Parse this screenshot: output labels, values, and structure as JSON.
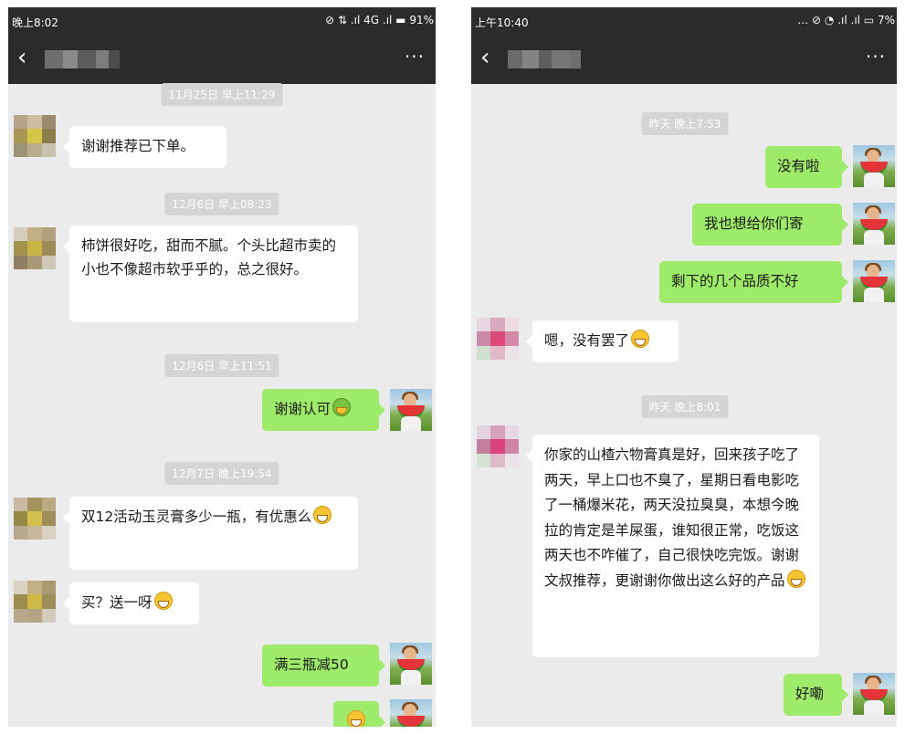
{
  "left_screen": {
    "status": {
      "time": "晚上8:02",
      "icons": "⊘ ⇅ .ıl 4G .ıl ▬ 91%"
    },
    "nav": {
      "back_label": "‹",
      "more_label": "···"
    },
    "messages": [
      {
        "type": "time",
        "text": "11月25日 早上11:29"
      },
      {
        "type": "in",
        "text": "谢谢推荐已下单。"
      },
      {
        "type": "time",
        "text": "12月6日 早上08:23"
      },
      {
        "type": "in",
        "text": "柿饼很好吃，甜而不腻。个头比超市卖的小也不像超市软乎乎的，总之很好。"
      },
      {
        "type": "time",
        "text": "12月6日 早上11:51"
      },
      {
        "type": "out",
        "text": "谢谢认可",
        "emoji": "green-face-emoji"
      },
      {
        "type": "time",
        "text": "12月7日 晚上19:54"
      },
      {
        "type": "in",
        "text": "双12活动玉灵膏多少一瓶，有优惠么",
        "emoji": "grin-emoji"
      },
      {
        "type": "in",
        "text": "买？送一呀",
        "emoji": "grin-emoji"
      },
      {
        "type": "out",
        "text": "满三瓶减50"
      },
      {
        "type": "out",
        "text": "",
        "emoji": "grin-emoji"
      }
    ]
  },
  "right_screen": {
    "status": {
      "time": "上午10:40",
      "icons": "… ⊘ ◔ .ıl .ıl ▭ 7%"
    },
    "nav": {
      "back_label": "‹",
      "more_label": "···"
    },
    "messages": [
      {
        "type": "time",
        "text": "昨天 晚上7:53"
      },
      {
        "type": "out",
        "text": "没有啦"
      },
      {
        "type": "out",
        "text": "我也想给你们寄"
      },
      {
        "type": "out",
        "text": "剩下的几个品质不好"
      },
      {
        "type": "in",
        "text": "嗯，没有罢了",
        "emoji": "grin-emoji"
      },
      {
        "type": "time",
        "text": "昨天 晚上8:01"
      },
      {
        "type": "in",
        "text": "你家的山楂六物膏真是好，回来孩子吃了两天，早上口也不臭了，星期日看电影吃了一桶爆米花，两天没拉臭臭，本想今晚拉的肯定是羊屎蛋，谁知很正常，吃饭这两天也不咋催了，自己很快吃完饭。谢谢文叔推荐，更谢谢你做出这么好的产品",
        "emoji": "grin-emoji"
      },
      {
        "type": "out",
        "text": "好嘞"
      }
    ]
  },
  "colors": {
    "out_bubble": "#9eea6a",
    "in_bubble": "#ffffff",
    "chat_bg": "#ebebeb",
    "header": "#2b2b2b",
    "timestamp_bg": "#d4d4d4"
  }
}
